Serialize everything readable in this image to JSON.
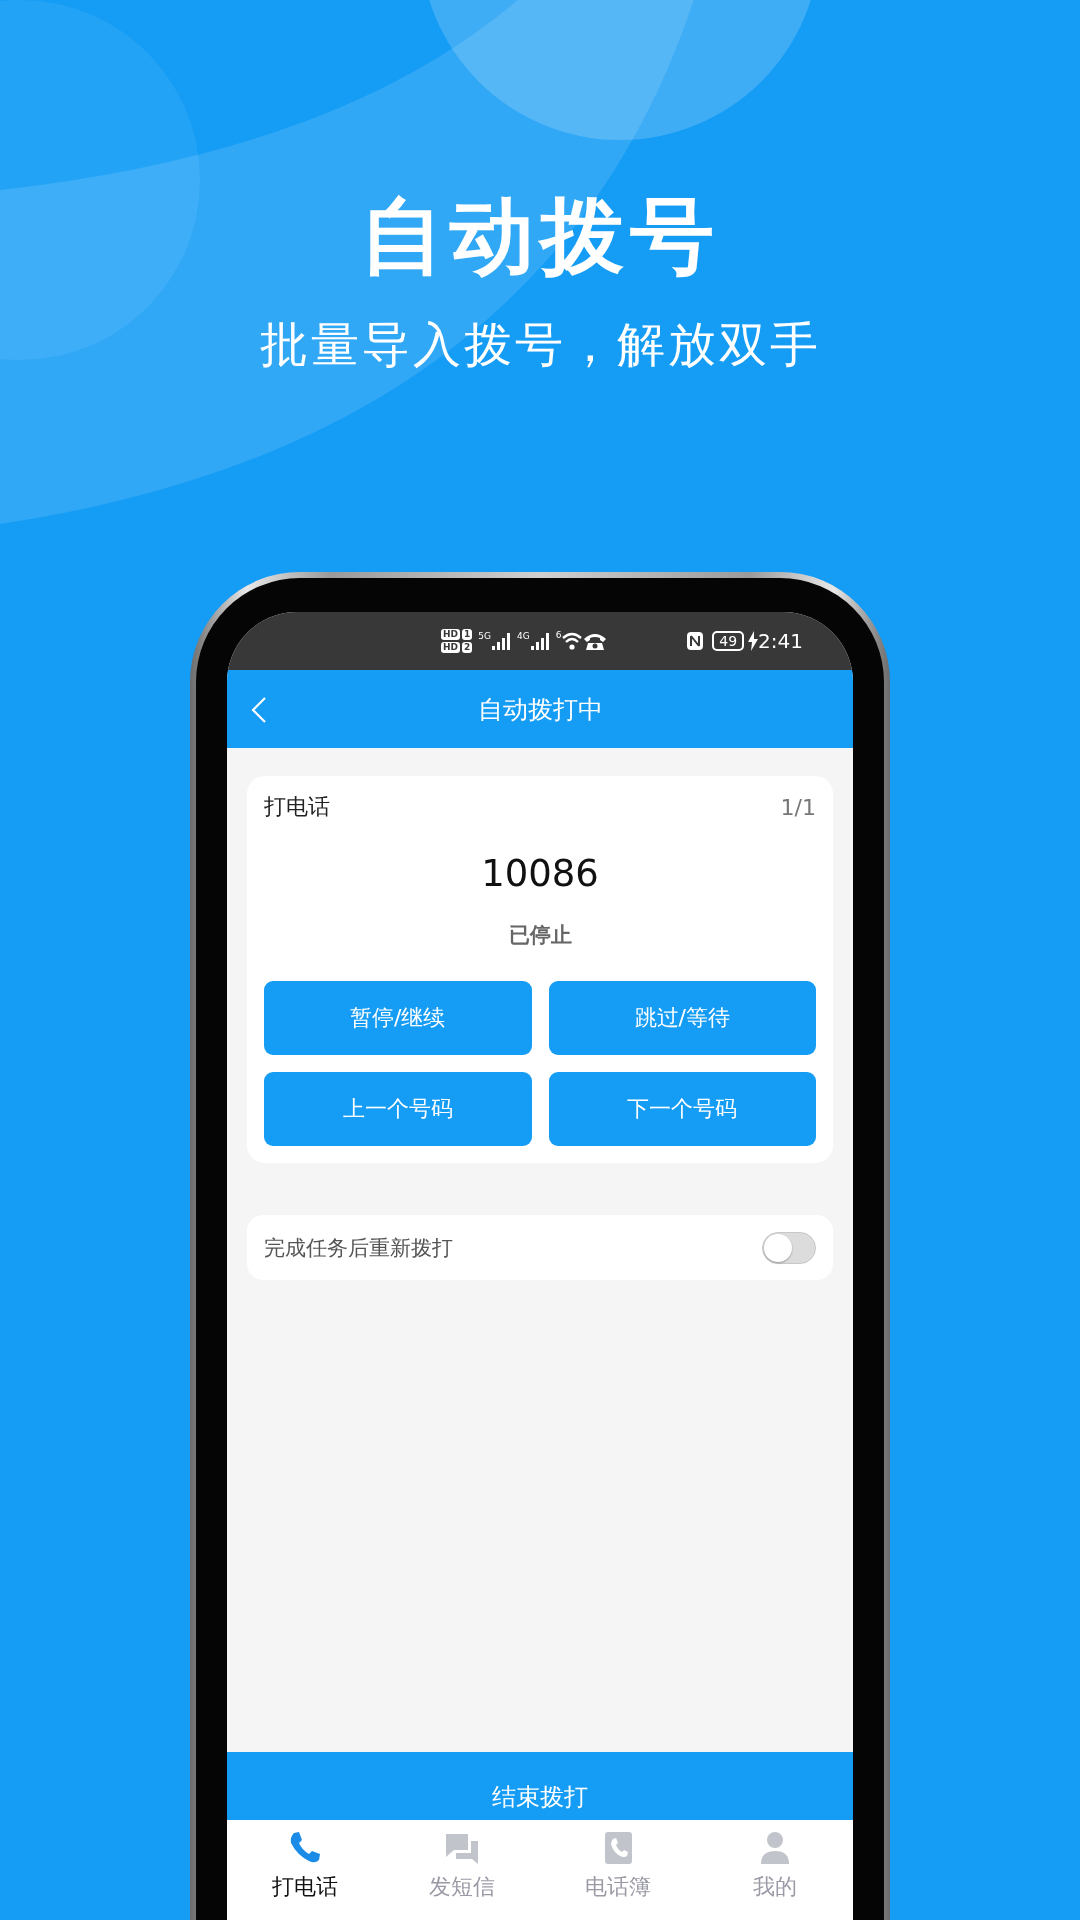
{
  "hero": {
    "title": "自动拨号",
    "subtitle": "批量导入拨号，解放双手"
  },
  "status_bar": {
    "sims": [
      {
        "badge": "HD",
        "slot": "1",
        "network": "5G"
      },
      {
        "badge": "HD",
        "slot": "2",
        "network": "4G"
      }
    ],
    "wifi_label": "6",
    "battery": "49",
    "time": "2:41"
  },
  "header": {
    "title": "自动拨打中"
  },
  "call_card": {
    "title": "打电话",
    "progress": "1/1",
    "number": "10086",
    "status": "已停止",
    "buttons": [
      "暂停/继续",
      "跳过/等待",
      "上一个号码",
      "下一个号码"
    ]
  },
  "settings": [
    {
      "label": "完成任务后重新拨打",
      "on": false
    }
  ],
  "end_button": "结束拨打",
  "tabs": [
    {
      "label": "打电话",
      "selected": true
    },
    {
      "label": "发短信",
      "selected": false
    },
    {
      "label": "电话簿",
      "selected": false
    },
    {
      "label": "我的",
      "selected": false
    }
  ]
}
